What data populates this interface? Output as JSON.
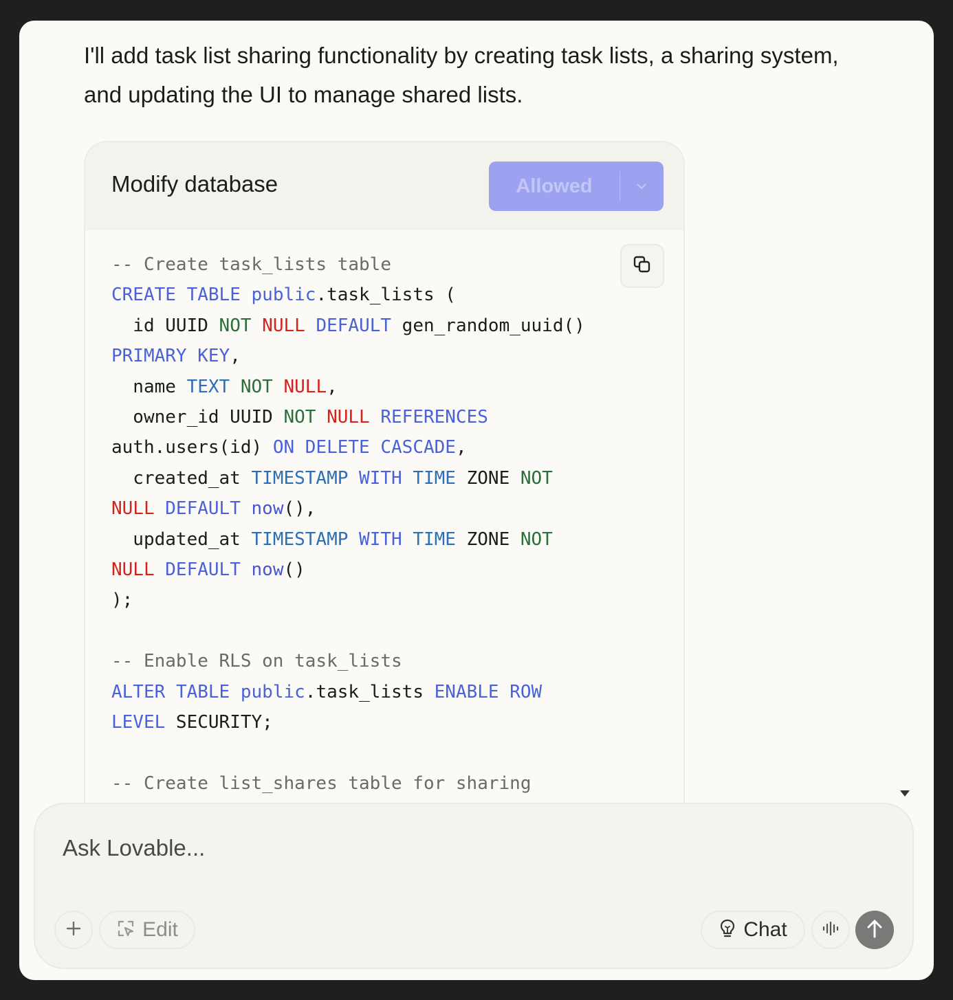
{
  "message": {
    "text": "I'll add task list sharing functionality by creating task lists, a sharing system, and updating the UI to manage shared lists."
  },
  "db_card": {
    "title": "Modify database",
    "allowed_label": "Allowed",
    "code_lines": [
      [
        {
          "t": "-- Create task_lists table",
          "c": "comment"
        }
      ],
      [
        {
          "t": "CREATE",
          "c": "kw"
        },
        {
          "t": " "
        },
        {
          "t": "TABLE",
          "c": "kw"
        },
        {
          "t": " "
        },
        {
          "t": "public",
          "c": "kw"
        },
        {
          "t": ".task_lists ("
        }
      ],
      [
        {
          "t": "  id UUID "
        },
        {
          "t": "NOT",
          "c": "green"
        },
        {
          "t": " "
        },
        {
          "t": "NULL",
          "c": "red"
        },
        {
          "t": " "
        },
        {
          "t": "DEFAULT",
          "c": "kw"
        },
        {
          "t": " gen_random_uuid()"
        }
      ],
      [
        {
          "t": "PRIMARY",
          "c": "kw"
        },
        {
          "t": " "
        },
        {
          "t": "KEY",
          "c": "kw"
        },
        {
          "t": ","
        }
      ],
      [
        {
          "t": "  name "
        },
        {
          "t": "TEXT",
          "c": "cyan"
        },
        {
          "t": " "
        },
        {
          "t": "NOT",
          "c": "green"
        },
        {
          "t": " "
        },
        {
          "t": "NULL",
          "c": "red"
        },
        {
          "t": ","
        }
      ],
      [
        {
          "t": "  owner_id UUID "
        },
        {
          "t": "NOT",
          "c": "green"
        },
        {
          "t": " "
        },
        {
          "t": "NULL",
          "c": "red"
        },
        {
          "t": " "
        },
        {
          "t": "REFERENCES",
          "c": "kw"
        }
      ],
      [
        {
          "t": "auth.users(id) "
        },
        {
          "t": "ON",
          "c": "kw"
        },
        {
          "t": " "
        },
        {
          "t": "DELETE",
          "c": "kw"
        },
        {
          "t": " "
        },
        {
          "t": "CASCADE",
          "c": "kw"
        },
        {
          "t": ","
        }
      ],
      [
        {
          "t": "  created_at "
        },
        {
          "t": "TIMESTAMP",
          "c": "cyan"
        },
        {
          "t": " "
        },
        {
          "t": "WITH",
          "c": "kw"
        },
        {
          "t": " "
        },
        {
          "t": "TIME",
          "c": "cyan"
        },
        {
          "t": " ZONE "
        },
        {
          "t": "NOT",
          "c": "green"
        }
      ],
      [
        {
          "t": "NULL",
          "c": "red"
        },
        {
          "t": " "
        },
        {
          "t": "DEFAULT",
          "c": "kw"
        },
        {
          "t": " "
        },
        {
          "t": "now",
          "c": "func"
        },
        {
          "t": "(),"
        }
      ],
      [
        {
          "t": "  updated_at "
        },
        {
          "t": "TIMESTAMP",
          "c": "cyan"
        },
        {
          "t": " "
        },
        {
          "t": "WITH",
          "c": "kw"
        },
        {
          "t": " "
        },
        {
          "t": "TIME",
          "c": "cyan"
        },
        {
          "t": " ZONE "
        },
        {
          "t": "NOT",
          "c": "green"
        }
      ],
      [
        {
          "t": "NULL",
          "c": "red"
        },
        {
          "t": " "
        },
        {
          "t": "DEFAULT",
          "c": "kw"
        },
        {
          "t": " "
        },
        {
          "t": "now",
          "c": "func"
        },
        {
          "t": "()"
        }
      ],
      [
        {
          "t": ");"
        }
      ],
      [
        {
          "t": ""
        }
      ],
      [
        {
          "t": "-- Enable RLS on task_lists",
          "c": "comment"
        }
      ],
      [
        {
          "t": "ALTER",
          "c": "kw"
        },
        {
          "t": " "
        },
        {
          "t": "TABLE",
          "c": "kw"
        },
        {
          "t": " "
        },
        {
          "t": "public",
          "c": "kw"
        },
        {
          "t": ".task_lists "
        },
        {
          "t": "ENABLE",
          "c": "kw"
        },
        {
          "t": " "
        },
        {
          "t": "ROW",
          "c": "kw"
        }
      ],
      [
        {
          "t": "LEVEL",
          "c": "kw"
        },
        {
          "t": " SECURITY;"
        }
      ],
      [
        {
          "t": ""
        }
      ],
      [
        {
          "t": "-- Create list_shares table for sharing",
          "c": "comment"
        }
      ]
    ]
  },
  "composer": {
    "placeholder": "Ask Lovable...",
    "edit_label": "Edit",
    "chat_label": "Chat"
  },
  "icons": {
    "copy": "copy-icon",
    "scroll_down": "arrow-down-icon",
    "plus": "plus-icon",
    "edit": "cursor-select-icon",
    "chat": "lightbulb-icon",
    "voice": "voice-wave-icon",
    "send": "arrow-up-icon"
  },
  "colors": {
    "accent": "#9da2f0",
    "keyword": "#4a61d8",
    "null": "#d1241f",
    "not": "#2b6e3a"
  }
}
